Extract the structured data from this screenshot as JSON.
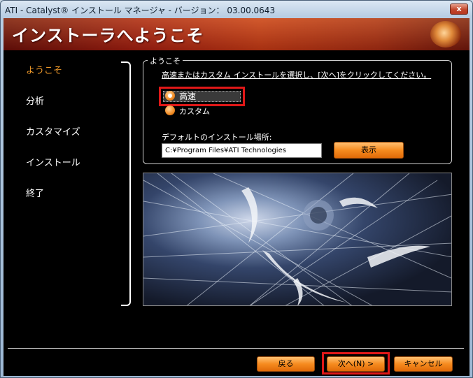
{
  "window": {
    "title": "ATI - Catalyst® インストール マネージャ - バージョン： 03.00.0643",
    "close_glyph": "x"
  },
  "banner": {
    "title": "インストーラへようこそ"
  },
  "nav": {
    "items": [
      {
        "label": "ようこそ",
        "active": true
      },
      {
        "label": "分析",
        "active": false
      },
      {
        "label": "カスタマイズ",
        "active": false
      },
      {
        "label": "インストール",
        "active": false
      },
      {
        "label": "終了",
        "active": false
      }
    ]
  },
  "welcome_group": {
    "legend": "ようこそ",
    "instruction": "高速またはカスタム インストールを選択し、[次へ]をクリックしてください。",
    "options": [
      {
        "label": "高速",
        "selected": true
      },
      {
        "label": "カスタム",
        "selected": false
      }
    ],
    "path_label": "デフォルトのインストール場所:",
    "path_value": "C:¥Program Files¥ATI Technologies",
    "browse_label": "表示"
  },
  "footer": {
    "back_label": "戻る",
    "next_label": "次へ(N) >",
    "cancel_label": "キャンセル"
  },
  "colors": {
    "accent": "#f68b1f",
    "active_nav": "#f09a2a",
    "highlight": "#e01818",
    "banner": "#a41e10"
  }
}
